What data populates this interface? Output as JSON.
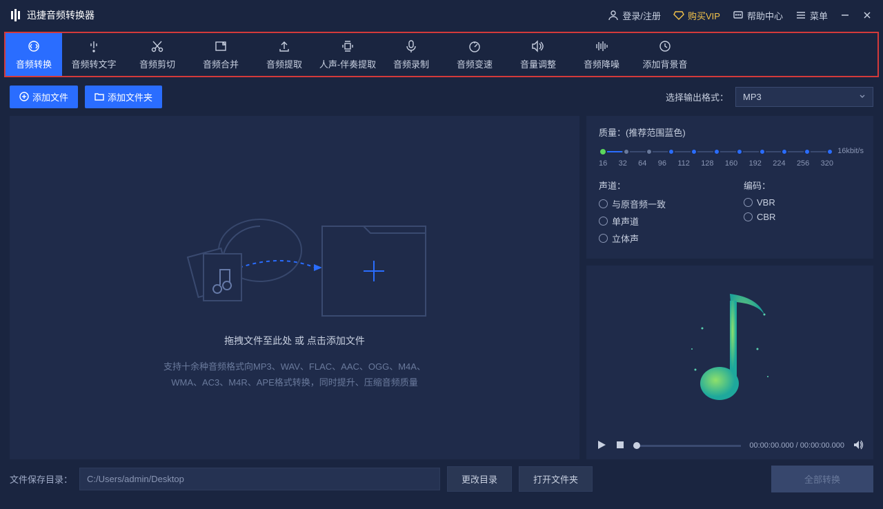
{
  "app": {
    "title": "迅捷音频转换器"
  },
  "titlebar": {
    "login": "登录/注册",
    "vip": "购买VIP",
    "help": "帮助中心",
    "menu": "菜单"
  },
  "tools": [
    {
      "label": "音频转换",
      "icon": "convert",
      "active": true
    },
    {
      "label": "音频转文字",
      "icon": "totext"
    },
    {
      "label": "音频剪切",
      "icon": "cut"
    },
    {
      "label": "音频合并",
      "icon": "merge"
    },
    {
      "label": "音频提取",
      "icon": "extract"
    },
    {
      "label": "人声-伴奏提取",
      "icon": "vocal"
    },
    {
      "label": "音频录制",
      "icon": "record"
    },
    {
      "label": "音频变速",
      "icon": "speed"
    },
    {
      "label": "音量调整",
      "icon": "volume"
    },
    {
      "label": "音频降噪",
      "icon": "noise"
    },
    {
      "label": "添加背景音",
      "icon": "bgm"
    }
  ],
  "secondbar": {
    "add_file": "添加文件",
    "add_folder": "添加文件夹",
    "output_fmt_label": "选择输出格式：",
    "output_fmt_value": "MP3"
  },
  "drop": {
    "text": "拖拽文件至此处 或 点击添加文件",
    "help1": "支持十余种音频格式向MP3、WAV、FLAC、AAC、OGG、M4A、",
    "help2": "WMA、AC3、M4R、APE格式转换，同时提升、压缩音频质量"
  },
  "quality": {
    "title": "质量：(推荐范围蓝色)",
    "ticks": [
      "16",
      "32",
      "64",
      "96",
      "112",
      "128",
      "160",
      "192",
      "224",
      "256",
      "320"
    ],
    "unit": "16kbit/s",
    "active_index": 0
  },
  "channel": {
    "title": "声道：",
    "options": [
      "与原音频一致",
      "单声道",
      "立体声"
    ]
  },
  "encoding": {
    "title": "编码：",
    "options": [
      "VBR",
      "CBR"
    ]
  },
  "player": {
    "time": "00:00:00.000 / 00:00:00.000"
  },
  "footer": {
    "save_label": "文件保存目录：",
    "path": "C:/Users/admin/Desktop",
    "change_dir": "更改目录",
    "open_dir": "打开文件夹",
    "convert_all": "全部转换"
  }
}
